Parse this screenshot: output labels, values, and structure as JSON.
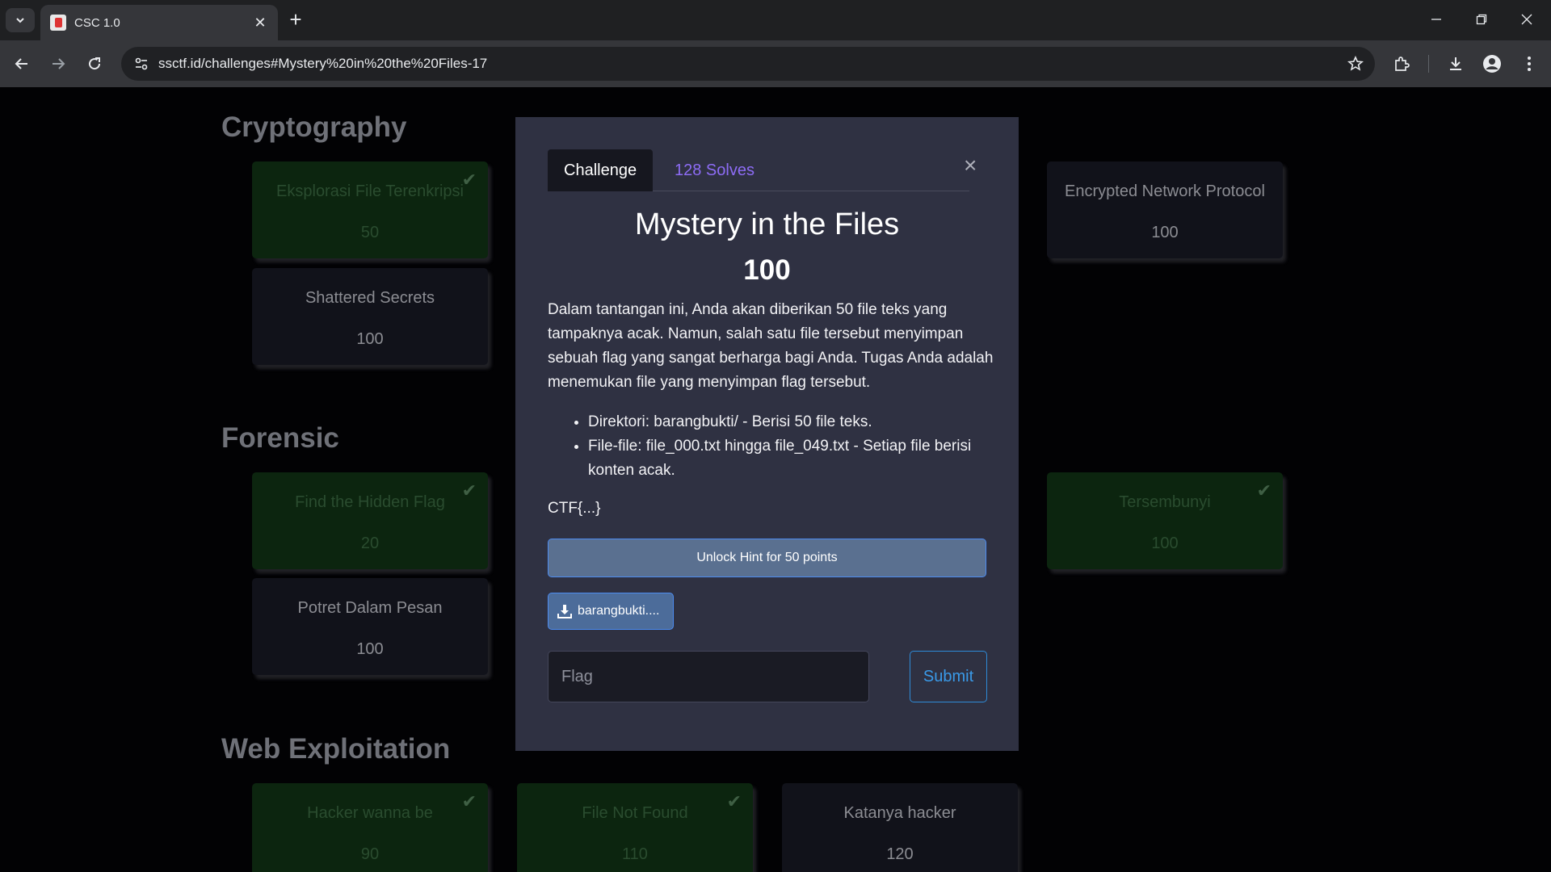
{
  "browser": {
    "tab_title": "CSC 1.0",
    "url": "ssctf.id/challenges#Mystery%20in%20the%20Files-17"
  },
  "categories": [
    {
      "title": "Cryptography",
      "cards": [
        {
          "name": "Eksplorasi File Terenkripsi",
          "points": "50",
          "solved": true
        },
        {
          "name": "Encrypted Network Protocol",
          "points": "100",
          "solved": false
        },
        {
          "name": "Shattered Secrets",
          "points": "100",
          "solved": false
        }
      ]
    },
    {
      "title": "Forensic",
      "cards": [
        {
          "name": "Find the Hidden Flag",
          "points": "20",
          "solved": true
        },
        {
          "name": "Tersembunyi",
          "points": "100",
          "solved": true
        },
        {
          "name": "Potret Dalam Pesan",
          "points": "100",
          "solved": false
        }
      ]
    },
    {
      "title": "Web Exploitation",
      "cards": [
        {
          "name": "Hacker wanna be",
          "points": "90",
          "solved": true
        },
        {
          "name": "File Not Found",
          "points": "110",
          "solved": true
        },
        {
          "name": "Katanya hacker",
          "points": "120",
          "solved": false
        }
      ]
    }
  ],
  "modal": {
    "tab_challenge": "Challenge",
    "tab_solves": "128 Solves",
    "close": "×",
    "title": "Mystery in the Files",
    "value": "100",
    "description": "Dalam tantangan ini, Anda akan diberikan 50 file teks yang tampaknya acak. Namun, salah satu file tersebut menyimpan sebuah flag yang sangat berharga bagi Anda. Tugas Anda adalah menemukan file yang menyimpan flag tersebut.",
    "bullets": [
      "Direktori: barangbukti/ - Berisi 50 file teks.",
      "File-file: file_000.txt hingga file_049.txt - Setiap file berisi konten acak."
    ],
    "flag_format": "CTF{...}",
    "hint_button": "Unlock Hint for 50 points",
    "download_button": "barangbukti....",
    "flag_placeholder": "Flag",
    "submit_button": "Submit"
  }
}
